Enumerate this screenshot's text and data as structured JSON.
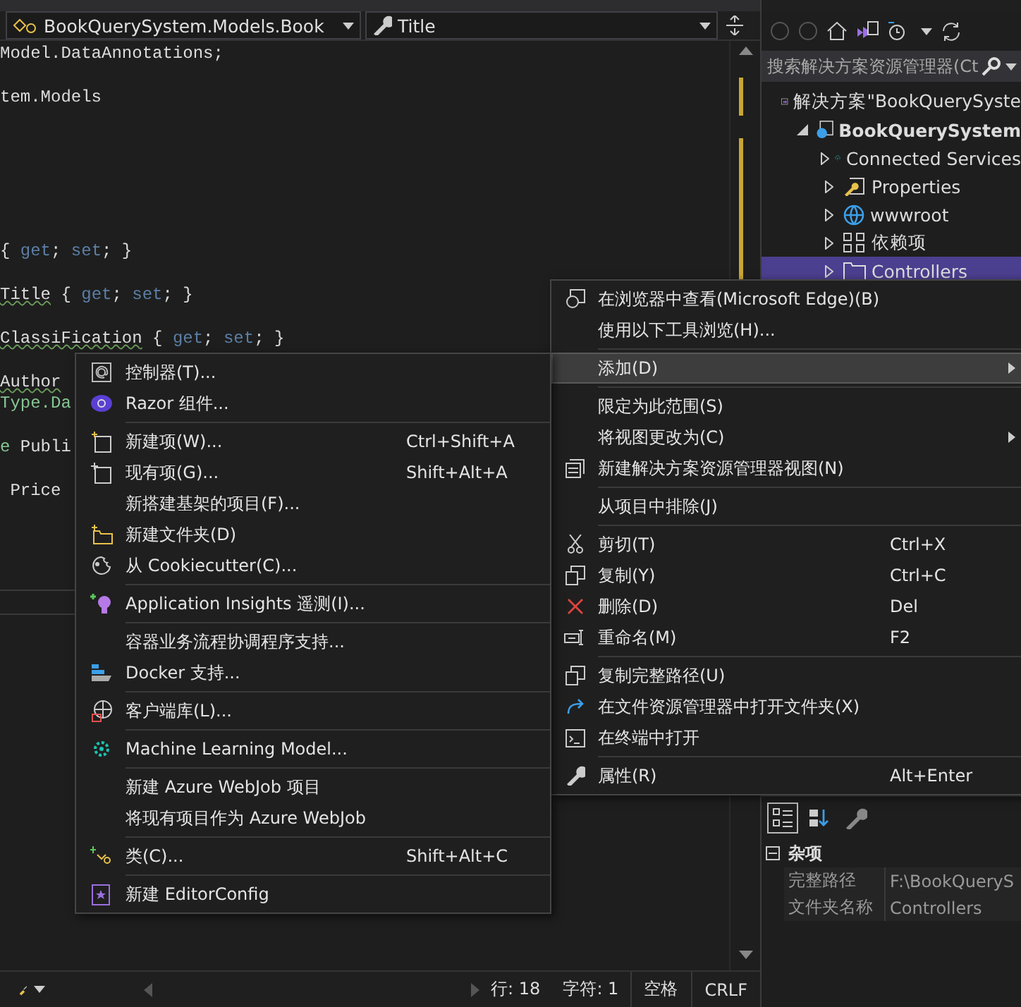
{
  "editor": {
    "nav_bar": {
      "type_dropdown": "BookQuerySystem.Models.Book",
      "member_dropdown": "Title"
    },
    "code_lines": [
      {
        "tokens": [
          {
            "text": "Model.DataAnnotations;",
            "kind": "plain"
          }
        ]
      },
      {
        "kind": "blank"
      },
      {
        "tokens": [
          {
            "text": "tem.Models",
            "kind": "plain"
          }
        ]
      },
      {
        "kind": "blank"
      },
      {
        "kind": "blank"
      },
      {
        "kind": "blank"
      },
      {
        "kind": "blank"
      },
      {
        "kind": "blank"
      },
      {
        "kind": "blank"
      },
      {
        "tokens": [
          {
            "text": "{ ",
            "kind": "plain"
          },
          {
            "text": "get",
            "kind": "keyword"
          },
          {
            "text": "; ",
            "kind": "plain"
          },
          {
            "text": "set",
            "kind": "keyword"
          },
          {
            "text": "; }",
            "kind": "plain"
          }
        ]
      },
      {
        "kind": "blank"
      },
      {
        "tokens": [
          {
            "text": "Title",
            "kind": "squiggle"
          },
          {
            "text": " { ",
            "kind": "plain"
          },
          {
            "text": "get",
            "kind": "keyword"
          },
          {
            "text": "; ",
            "kind": "plain"
          },
          {
            "text": "set",
            "kind": "keyword"
          },
          {
            "text": "; }",
            "kind": "plain"
          }
        ]
      },
      {
        "kind": "blank"
      },
      {
        "tokens": [
          {
            "text": "ClassiFication",
            "kind": "squiggle"
          },
          {
            "text": " { ",
            "kind": "plain"
          },
          {
            "text": "get",
            "kind": "keyword"
          },
          {
            "text": "; ",
            "kind": "plain"
          },
          {
            "text": "set",
            "kind": "keyword"
          },
          {
            "text": "; }",
            "kind": "plain"
          }
        ]
      },
      {
        "kind": "blank"
      },
      {
        "tokens": [
          {
            "text": "Author",
            "kind": "squiggle"
          }
        ]
      },
      {
        "tokens": [
          {
            "text": "Type.Da",
            "kind": "type"
          }
        ]
      },
      {
        "kind": "blank"
      },
      {
        "tokens": [
          {
            "text": "e",
            "kind": "type"
          },
          {
            "text": " Publi",
            "kind": "plain"
          }
        ]
      },
      {
        "kind": "blank"
      },
      {
        "tokens": [
          {
            "text": " Price",
            "kind": "plain"
          }
        ]
      }
    ],
    "status_bar": {
      "line": "行: 18",
      "char": "字符: 1",
      "indent": "空格",
      "line_ending": "CRLF"
    }
  },
  "solution_explorer": {
    "search": {
      "placeholder": "搜索解决方案资源管理器(Ct"
    },
    "tree": [
      {
        "label": "解决方案\"BookQuerySyste",
        "kind": "solution",
        "children": [
          {
            "label": "BookQuerySystem",
            "kind": "project",
            "expanded": true,
            "selected": false,
            "children": [
              {
                "label": "Connected Services",
                "kind": "services",
                "expanded": false,
                "selected": false
              },
              {
                "label": "Properties",
                "kind": "properties",
                "expanded": false,
                "selected": false
              },
              {
                "label": "wwwroot",
                "kind": "web",
                "expanded": false,
                "selected": false
              },
              {
                "label": "依赖项",
                "kind": "dependencies",
                "expanded": false,
                "selected": false
              },
              {
                "label": "Controllers",
                "kind": "folder",
                "expanded": false,
                "selected": true
              }
            ]
          }
        ]
      }
    ]
  },
  "properties": {
    "category": {
      "label": "杂项",
      "expanded": true
    },
    "rows": [
      {
        "name": "完整路径",
        "value": "F:\\BookQueryS"
      },
      {
        "name": "文件夹名称",
        "value": "Controllers"
      }
    ]
  },
  "context_menu": [
    {
      "kind": "item",
      "label": "在浏览器中查看(Microsoft Edge)(B)",
      "selected": false
    },
    {
      "kind": "item",
      "label": "使用以下工具浏览(H)...",
      "selected": false
    },
    {
      "kind": "separator"
    },
    {
      "kind": "item",
      "label": "添加(D)",
      "selected": true,
      "submenu": true
    },
    {
      "kind": "separator"
    },
    {
      "kind": "item",
      "label": "限定为此范围(S)",
      "selected": false
    },
    {
      "kind": "item",
      "label": "将视图更改为(C)",
      "selected": false,
      "submenu": true
    },
    {
      "kind": "item",
      "label": "新建解决方案资源管理器视图(N)",
      "selected": false
    },
    {
      "kind": "separator"
    },
    {
      "kind": "item",
      "label": "从项目中排除(J)",
      "selected": false
    },
    {
      "kind": "separator"
    },
    {
      "kind": "item",
      "label": "剪切(T)",
      "shortcut": "Ctrl+X",
      "selected": false
    },
    {
      "kind": "item",
      "label": "复制(Y)",
      "shortcut": "Ctrl+C",
      "selected": false
    },
    {
      "kind": "item",
      "label": "删除(D)",
      "shortcut": "Del",
      "selected": false
    },
    {
      "kind": "item",
      "label": "重命名(M)",
      "shortcut": "F2",
      "selected": false
    },
    {
      "kind": "separator"
    },
    {
      "kind": "item",
      "label": "复制完整路径(U)",
      "selected": false
    },
    {
      "kind": "item",
      "label": "在文件资源管理器中打开文件夹(X)",
      "selected": false
    },
    {
      "kind": "item",
      "label": "在终端中打开",
      "selected": false
    },
    {
      "kind": "separator"
    },
    {
      "kind": "item",
      "label": "属性(R)",
      "shortcut": "Alt+Enter",
      "selected": false
    }
  ],
  "add_submenu": [
    {
      "kind": "item",
      "label": "控制器(T)...",
      "selected": false
    },
    {
      "kind": "item",
      "label": "Razor 组件...",
      "selected": false
    },
    {
      "kind": "separator"
    },
    {
      "kind": "item",
      "label": "新建项(W)...",
      "shortcut": "Ctrl+Shift+A",
      "selected": false
    },
    {
      "kind": "item",
      "label": "现有项(G)...",
      "shortcut": "Shift+Alt+A",
      "selected": false
    },
    {
      "kind": "item",
      "label": "新搭建基架的项目(F)...",
      "selected": false
    },
    {
      "kind": "item",
      "label": "新建文件夹(D)",
      "selected": false
    },
    {
      "kind": "item",
      "label": "从 Cookiecutter(C)...",
      "selected": false
    },
    {
      "kind": "separator"
    },
    {
      "kind": "item",
      "label": "Application Insights 遥测(I)...",
      "selected": false
    },
    {
      "kind": "separator"
    },
    {
      "kind": "item",
      "label": "容器业务流程协调程序支持...",
      "selected": false
    },
    {
      "kind": "item",
      "label": "Docker 支持...",
      "selected": false
    },
    {
      "kind": "separator"
    },
    {
      "kind": "item",
      "label": "客户端库(L)...",
      "selected": false
    },
    {
      "kind": "separator"
    },
    {
      "kind": "item",
      "label": "Machine Learning Model...",
      "selected": false
    },
    {
      "kind": "separator"
    },
    {
      "kind": "item",
      "label": "新建 Azure WebJob 项目",
      "selected": false
    },
    {
      "kind": "item",
      "label": "将现有项目作为 Azure WebJob",
      "selected": false
    },
    {
      "kind": "separator"
    },
    {
      "kind": "item",
      "label": "类(C)...",
      "shortcut": "Shift+Alt+C",
      "selected": false
    },
    {
      "kind": "separator"
    },
    {
      "kind": "item",
      "label": "新建 EditorConfig",
      "selected": false
    }
  ]
}
